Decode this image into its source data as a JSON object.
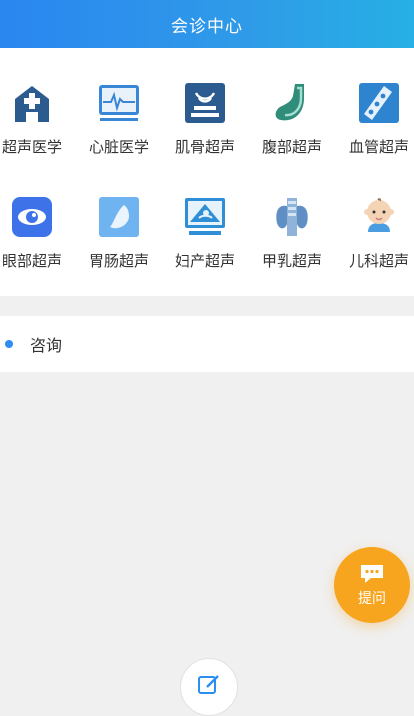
{
  "header": {
    "title": "会诊中心"
  },
  "categories": [
    {
      "label": "超声医学",
      "icon": "hospital-icon"
    },
    {
      "label": "心脏医学",
      "icon": "ecg-monitor-icon"
    },
    {
      "label": "肌骨超声",
      "icon": "ultrasound-probe-icon"
    },
    {
      "label": "腹部超声",
      "icon": "stomach-icon"
    },
    {
      "label": "血管超声",
      "icon": "blood-vessel-icon"
    },
    {
      "label": "眼部超声",
      "icon": "eye-icon"
    },
    {
      "label": "胃肠超声",
      "icon": "intestine-icon"
    },
    {
      "label": "妇产超声",
      "icon": "fetal-ultrasound-icon"
    },
    {
      "label": "甲乳超声",
      "icon": "thyroid-icon"
    },
    {
      "label": "儿科超声",
      "icon": "baby-icon"
    }
  ],
  "consult": {
    "title": "咨询"
  },
  "fab": {
    "label": "提问",
    "icon": "chat-bubble-icon"
  },
  "bottom_nav": {
    "icon": "edit-icon"
  },
  "colors": {
    "header_start": "#2a86f0",
    "header_end": "#26b0e4",
    "accent": "#2b8ef0",
    "fab": "#f7a41f"
  }
}
